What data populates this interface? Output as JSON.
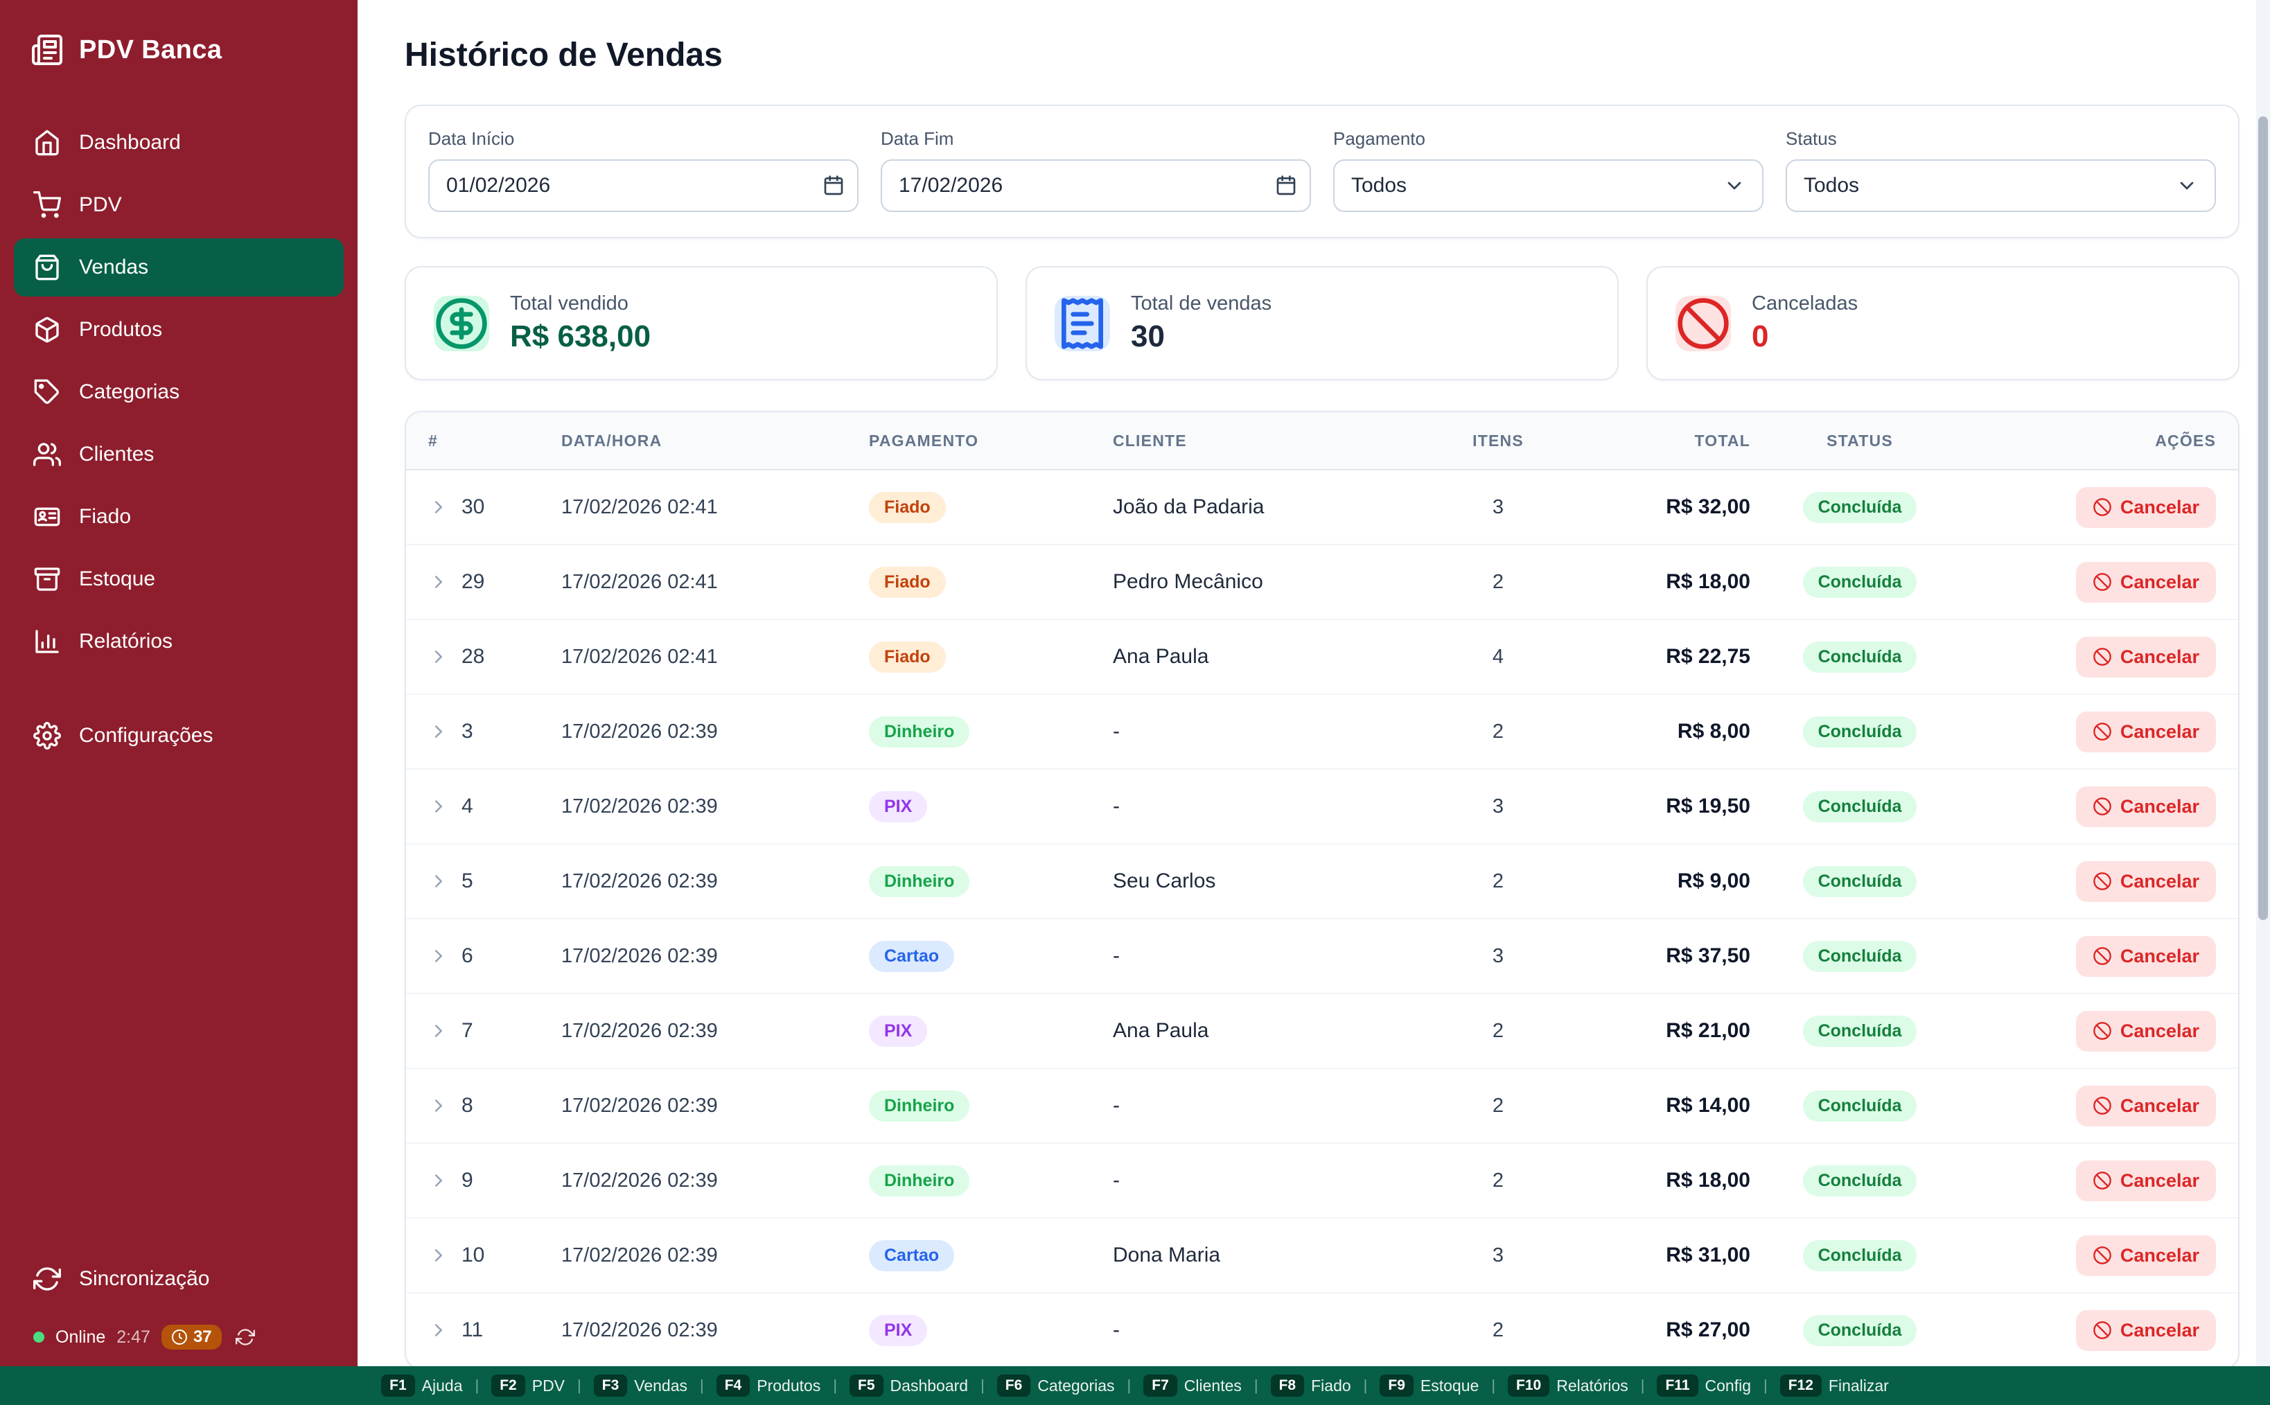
{
  "app": {
    "title": "PDV Banca"
  },
  "colors": {
    "sidebar_bg": "#8e1e2d",
    "active_green": "#065f46",
    "footer_bg": "#065f46",
    "success_green": "#15803d",
    "danger_red": "#dc2626",
    "pending_orange": "#b45309"
  },
  "sidebar": {
    "items": [
      {
        "label": "Dashboard",
        "icon": "home",
        "active": false
      },
      {
        "label": "PDV",
        "icon": "cart",
        "active": false
      },
      {
        "label": "Vendas",
        "icon": "bag",
        "active": true
      },
      {
        "label": "Produtos",
        "icon": "box",
        "active": false
      },
      {
        "label": "Categorias",
        "icon": "tag",
        "active": false
      },
      {
        "label": "Clientes",
        "icon": "users",
        "active": false
      },
      {
        "label": "Fiado",
        "icon": "idcard",
        "active": false
      },
      {
        "label": "Estoque",
        "icon": "archive",
        "active": false
      },
      {
        "label": "Relatórios",
        "icon": "chart",
        "active": false
      }
    ],
    "settings_label": "Configurações",
    "sync_label": "Sincronização",
    "status": {
      "online_label": "Online",
      "time": "2:47",
      "pending_count": "37"
    }
  },
  "header": {
    "title": "Histórico de Vendas"
  },
  "filters": {
    "date_start": {
      "label": "Data Início",
      "value": "01/02/2026"
    },
    "date_end": {
      "label": "Data Fim",
      "value": "17/02/2026"
    },
    "payment": {
      "label": "Pagamento",
      "value": "Todos"
    },
    "status": {
      "label": "Status",
      "value": "Todos"
    }
  },
  "stats": [
    {
      "label": "Total vendido",
      "value": "R$ 638,00",
      "icon": "dollar",
      "accent": "green"
    },
    {
      "label": "Total de vendas",
      "value": "30",
      "icon": "receipt",
      "accent": "blue"
    },
    {
      "label": "Canceladas",
      "value": "0",
      "icon": "ban",
      "accent": "red"
    }
  ],
  "table": {
    "headers": [
      "#",
      "DATA/HORA",
      "PAGAMENTO",
      "CLIENTE",
      "ITENS",
      "TOTAL",
      "STATUS",
      "AÇÕES"
    ],
    "cancel_label": "Cancelar",
    "rows": [
      {
        "id": "30",
        "datetime": "17/02/2026 02:41",
        "payment": "Fiado",
        "client": "João da Padaria",
        "items": "3",
        "total": "R$ 32,00",
        "status": "Concluída"
      },
      {
        "id": "29",
        "datetime": "17/02/2026 02:41",
        "payment": "Fiado",
        "client": "Pedro Mecânico",
        "items": "2",
        "total": "R$ 18,00",
        "status": "Concluída"
      },
      {
        "id": "28",
        "datetime": "17/02/2026 02:41",
        "payment": "Fiado",
        "client": "Ana Paula",
        "items": "4",
        "total": "R$ 22,75",
        "status": "Concluída"
      },
      {
        "id": "3",
        "datetime": "17/02/2026 02:39",
        "payment": "Dinheiro",
        "client": "-",
        "items": "2",
        "total": "R$ 8,00",
        "status": "Concluída"
      },
      {
        "id": "4",
        "datetime": "17/02/2026 02:39",
        "payment": "PIX",
        "client": "-",
        "items": "3",
        "total": "R$ 19,50",
        "status": "Concluída"
      },
      {
        "id": "5",
        "datetime": "17/02/2026 02:39",
        "payment": "Dinheiro",
        "client": "Seu Carlos",
        "items": "2",
        "total": "R$ 9,00",
        "status": "Concluída"
      },
      {
        "id": "6",
        "datetime": "17/02/2026 02:39",
        "payment": "Cartao",
        "client": "-",
        "items": "3",
        "total": "R$ 37,50",
        "status": "Concluída"
      },
      {
        "id": "7",
        "datetime": "17/02/2026 02:39",
        "payment": "PIX",
        "client": "Ana Paula",
        "items": "2",
        "total": "R$ 21,00",
        "status": "Concluída"
      },
      {
        "id": "8",
        "datetime": "17/02/2026 02:39",
        "payment": "Dinheiro",
        "client": "-",
        "items": "2",
        "total": "R$ 14,00",
        "status": "Concluída"
      },
      {
        "id": "9",
        "datetime": "17/02/2026 02:39",
        "payment": "Dinheiro",
        "client": "-",
        "items": "2",
        "total": "R$ 18,00",
        "status": "Concluída"
      },
      {
        "id": "10",
        "datetime": "17/02/2026 02:39",
        "payment": "Cartao",
        "client": "Dona Maria",
        "items": "3",
        "total": "R$ 31,00",
        "status": "Concluída"
      },
      {
        "id": "11",
        "datetime": "17/02/2026 02:39",
        "payment": "PIX",
        "client": "-",
        "items": "2",
        "total": "R$ 27,00",
        "status": "Concluída"
      }
    ]
  },
  "footer": {
    "separator": "|",
    "shortcuts": [
      {
        "key": "F1",
        "label": "Ajuda"
      },
      {
        "key": "F2",
        "label": "PDV"
      },
      {
        "key": "F3",
        "label": "Vendas"
      },
      {
        "key": "F4",
        "label": "Produtos"
      },
      {
        "key": "F5",
        "label": "Dashboard"
      },
      {
        "key": "F6",
        "label": "Categorias"
      },
      {
        "key": "F7",
        "label": "Clientes"
      },
      {
        "key": "F8",
        "label": "Fiado"
      },
      {
        "key": "F9",
        "label": "Estoque"
      },
      {
        "key": "F10",
        "label": "Relatórios"
      },
      {
        "key": "F11",
        "label": "Config"
      },
      {
        "key": "F12",
        "label": "Finalizar"
      }
    ]
  }
}
